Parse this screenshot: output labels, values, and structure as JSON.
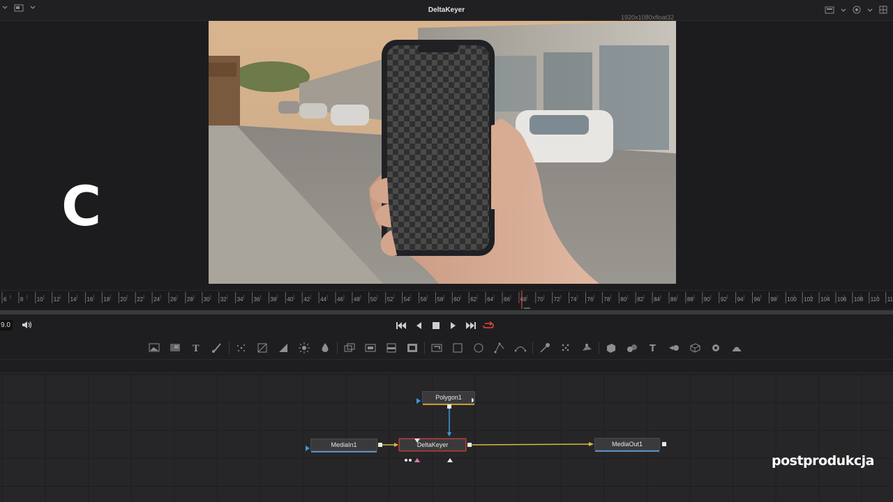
{
  "viewer": {
    "title": "DeltaKeyer",
    "resolution": "1920x1080xfloat32",
    "overlay_letter": "C"
  },
  "ruler": {
    "ticks": [
      "6",
      "8",
      "10",
      "12",
      "14",
      "16",
      "18",
      "20",
      "22",
      "24",
      "26",
      "28",
      "30",
      "32",
      "34",
      "36",
      "38",
      "40",
      "42",
      "44",
      "46",
      "48",
      "50",
      "52",
      "54",
      "56",
      "58",
      "60",
      "62",
      "64",
      "66",
      "68",
      "70",
      "72",
      "74",
      "76",
      "78",
      "80",
      "82",
      "84",
      "86",
      "88",
      "90",
      "92",
      "94",
      "96",
      "98",
      "100",
      "102",
      "104",
      "106",
      "108",
      "110",
      "112"
    ],
    "current_frame": 69,
    "playhead_color": "#e0483a"
  },
  "transport": {
    "frame_value": "9.0",
    "buttons": [
      "go-to-start-icon",
      "play-reverse-icon",
      "stop-icon",
      "play-icon",
      "go-to-end-icon",
      "loop-icon"
    ]
  },
  "toolbar": {
    "tools": [
      "background-icon",
      "paint-icon",
      "text-icon",
      "brush-icon",
      "particle-icon",
      "mask-icon",
      "gradient-icon",
      "glow-icon",
      "blur-icon",
      "merge-icon",
      "transform-icon",
      "channel-icon",
      "color-icon",
      "crop-icon",
      "rectangle-mask-icon",
      "ellipse-mask-icon",
      "polygon-mask-icon",
      "bspline-mask-icon",
      "tracker-icon",
      "planar-tracker-icon",
      "camera-tracker-icon",
      "shape3d-icon",
      "merge3d-icon",
      "text3d-icon",
      "renderer3d-icon",
      "imageplane3d-icon",
      "light3d-icon",
      "spotlight3d-icon"
    ]
  },
  "nodes": {
    "polygon": "Polygon1",
    "media_in": "MediaIn1",
    "delta_keyer": "DeltaKeyer",
    "media_out": "MediaOut1"
  },
  "colors": {
    "link_yellow": "#d8b93a",
    "link_blue": "#3a9be0",
    "node_selected": "#b0433b"
  },
  "watermark": "postprodukcja"
}
